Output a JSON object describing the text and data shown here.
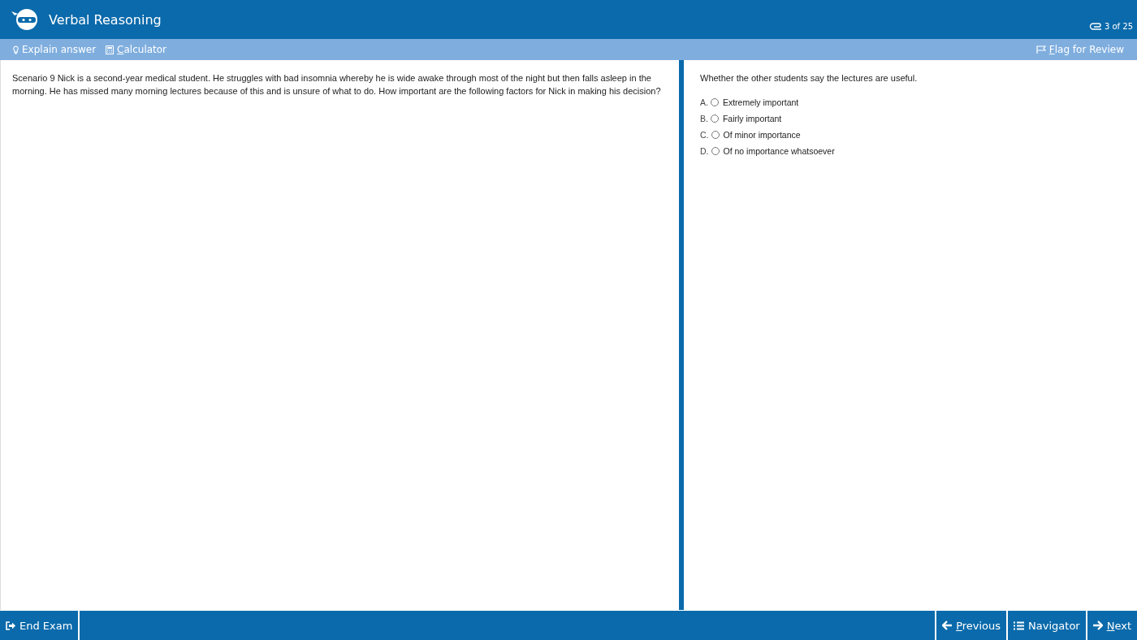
{
  "header": {
    "title": "Verbal Reasoning",
    "progress": "3 of 25"
  },
  "toolbar": {
    "left": [
      {
        "kind": "bulb",
        "label": "Explain answer",
        "underline_first": false
      },
      {
        "kind": "calculator",
        "label": "Calculator",
        "underline_first": true
      }
    ],
    "right": [
      {
        "kind": "flag",
        "label": "Flag for Review",
        "underline_first": true
      }
    ]
  },
  "scenario": "Scenario 9 Nick is a second-year medical student. He struggles with bad insomnia whereby he is wide awake through most of the night but then falls asleep in the morning. He has missed many morning lectures because of this and is unsure of what to do. How important are the following factors for Nick in making his decision?",
  "question": "Whether the other students say the lectures are useful.",
  "options": [
    {
      "letter": "A.",
      "label": "Extremely important",
      "selected": false
    },
    {
      "letter": "B.",
      "label": "Fairly important",
      "selected": false
    },
    {
      "letter": "C.",
      "label": "Of minor importance",
      "selected": false
    },
    {
      "letter": "D.",
      "label": "Of no importance whatsoever",
      "selected": false
    }
  ],
  "footer": {
    "left": [
      {
        "kind": "exit",
        "label": "End Exam",
        "underline_first": false
      }
    ],
    "right": [
      {
        "kind": "prev",
        "label": "Previous",
        "underline_first": true
      },
      {
        "kind": "list",
        "label": "Navigator",
        "underline_first": false
      },
      {
        "kind": "next",
        "label": "Next",
        "underline_first": true
      }
    ]
  }
}
